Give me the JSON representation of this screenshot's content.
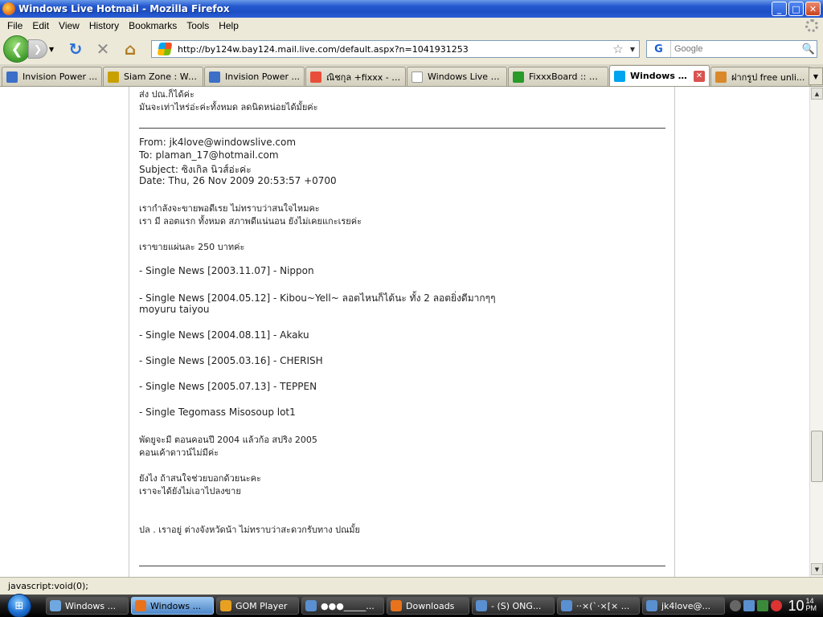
{
  "window": {
    "title": "Windows Live Hotmail - Mozilla Firefox",
    "min": "_",
    "max": "□",
    "close": "✕"
  },
  "menu": [
    "File",
    "Edit",
    "View",
    "History",
    "Bookmarks",
    "Tools",
    "Help"
  ],
  "nav": {
    "back": "❮",
    "forward": "❯",
    "history_drop": "▼",
    "reload": "↻",
    "stop": "✕",
    "home": "⌂",
    "url": "http://by124w.bay124.mail.live.com/default.aspx?n=1041931253",
    "star": "☆",
    "url_drop": "▼",
    "search_engine": "G",
    "search_placeholder": "Google",
    "search_go": "🔍"
  },
  "tabs": [
    {
      "label": "Invision Power ...",
      "color": "#3b6fc8"
    },
    {
      "label": "Siam Zone : We...",
      "color": "#c8a000"
    },
    {
      "label": "Invision Power ...",
      "color": "#3b6fc8"
    },
    {
      "label": "ณิชกุล +fixxx - ค้...",
      "color": "#e94e3a"
    },
    {
      "label": "Windows Live H...",
      "color": "#ffffff"
    },
    {
      "label": "FixxxBoard :: Ha...",
      "color": "#2a9a2a"
    },
    {
      "label": "Windows Li...",
      "color": "#00a4ef",
      "active": true
    },
    {
      "label": "ฝากรูป free unli...",
      "color": "#d9892a"
    }
  ],
  "tab_close": "✕",
  "tab_list": "▼",
  "mail": {
    "top_lines": [
      "ส่ง ปณ.ก็ได้ค่ะ",
      "มันจะเท่าไหร่อ่ะค่ะทั้งหมด ลดนิดหน่อยได้มั้ยค่ะ"
    ],
    "from": "From: jk4love@windowslive.com",
    "to": "To: plaman_17@hotmail.com",
    "subject": "Subject: ซิงเกิล นิวส์อ่ะค่ะ",
    "date": "Date: Thu, 26 Nov 2009 20:53:57 +0700",
    "body1": "เรากำลังจะขายพอดีเรย ไม่ทราบว่าสนใจไหมคะ",
    "body2": "เรา มี ลอตแรก ทั้งหมด สภาพดีแน่นอน ยังไม่เคยแกะเรยค่ะ",
    "price": "เราขายแผ่นละ 250 บาทค่ะ",
    "items": [
      "- Single News [2003.11.07] - Nippon",
      "- Single News [2004.05.12] - Kibou~Yell~ ลอตไหนก็ได้นะ ทั้ง 2 ลอตยิ่งดีมากๆๆ",
      "moyuru taiyou",
      "- Single News [2004.08.11] - Akaku",
      "- Single News [2005.03.16] - CHERISH",
      "- Single News [2005.07.13] - TEPPEN",
      "- Single Tegomass Misosoup lot1"
    ],
    "extra1": "พัดยูจะมี ตอนคอนปี 2004    แล้วก้อ สปริง 2005",
    "extra2": "คอนเค้าดาวน์ไม่มีค่ะ",
    "extra3": "ยังไง ถ้าสนใจช่วยบอกด้วยนะคะ",
    "extra4": "เราจะได้ยังไม่เอาไปลงขาย",
    "location": "ปล .   เราอยู่ ต่างจังหวัดน้า   ไม่ทราบว่าสะดวกรับทาง  ปณมั้ย"
  },
  "scroll": {
    "up": "▲",
    "down": "▼"
  },
  "status": "javascript:void(0);",
  "taskbar": {
    "start": "⊞",
    "items": [
      {
        "label": "Windows ...",
        "color": "#6fa8e0"
      },
      {
        "label": "Windows ...",
        "color": "#e8731c",
        "active": true
      },
      {
        "label": "GOM Player",
        "color": "#e8a020"
      },
      {
        "label": "●●●_____...",
        "color": "#5a8fd0"
      },
      {
        "label": "Downloads",
        "color": "#e8731c"
      },
      {
        "label": "- (S) ONG...",
        "color": "#5a8fd0"
      },
      {
        "label": "··×(`·×[× ...",
        "color": "#5a8fd0"
      },
      {
        "label": "jk4love@...",
        "color": "#5a8fd0"
      }
    ],
    "clock_hour": "10",
    "clock_min": "14",
    "clock_ampm": "PM"
  }
}
